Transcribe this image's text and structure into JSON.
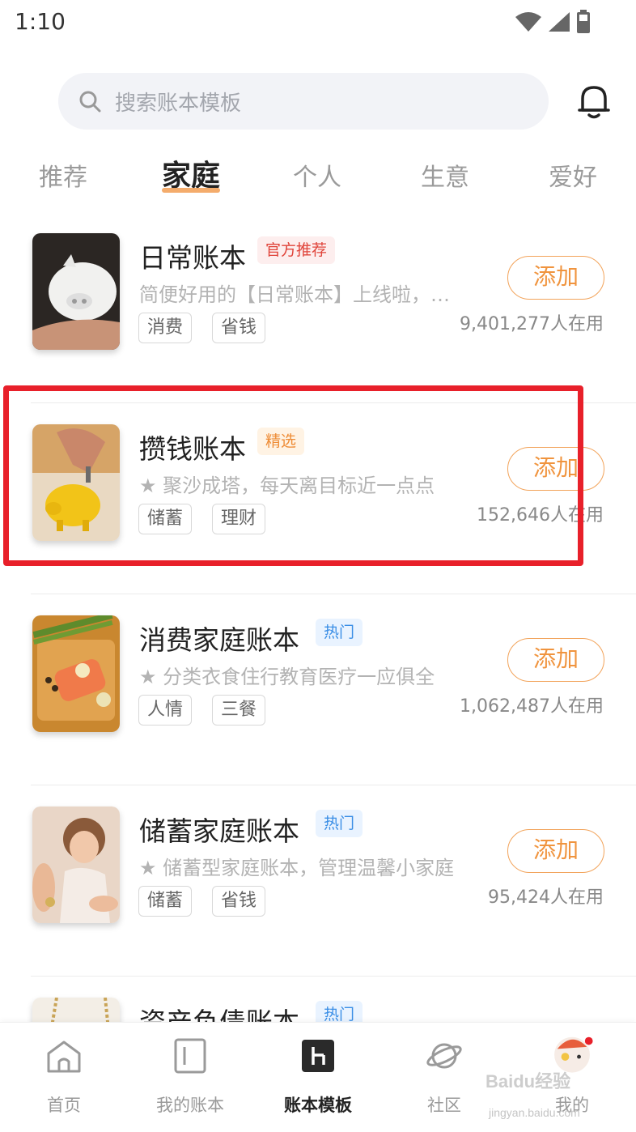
{
  "status_bar": {
    "time": "1:10"
  },
  "search": {
    "placeholder": "搜索账本模板"
  },
  "tabs": [
    {
      "label": "推荐",
      "active": false
    },
    {
      "label": "家庭",
      "active": true
    },
    {
      "label": "个人",
      "active": false
    },
    {
      "label": "生意",
      "active": false
    },
    {
      "label": "爱好",
      "active": false
    }
  ],
  "items": [
    {
      "title": "日常账本",
      "badge": "官方推荐",
      "badge_color": "#e0443a",
      "desc": "简便好用的【日常账本】上线啦，快来添加体验吧",
      "tags": [
        "消费",
        "省钱"
      ],
      "button": "添加",
      "users": "9,401,277人在用"
    },
    {
      "title": "攒钱账本",
      "badge": "精选",
      "badge_color": "#ee8c36",
      "desc": "★ 聚沙成塔，每天离目标近一点点",
      "tags": [
        "储蓄",
        "理财"
      ],
      "button": "添加",
      "users": "152,646人在用"
    },
    {
      "title": "消费家庭账本",
      "badge": "热门",
      "badge_color": "#3a8ee6",
      "desc": "★ 分类衣食住行教育医疗一应俱全",
      "tags": [
        "人情",
        "三餐"
      ],
      "button": "添加",
      "users": "1,062,487人在用"
    },
    {
      "title": "储蓄家庭账本",
      "badge": "热门",
      "badge_color": "#3a8ee6",
      "desc": "★ 储蓄型家庭账本，管理温馨小家庭",
      "tags": [
        "储蓄",
        "省钱"
      ],
      "button": "添加",
      "users": "95,424人在用"
    },
    {
      "title": "资产负债账本",
      "badge": "热门",
      "badge_color": "#3a8ee6"
    }
  ],
  "bottom_nav": [
    {
      "label": "首页",
      "icon": "home-icon"
    },
    {
      "label": "我的账本",
      "icon": "book-icon"
    },
    {
      "label": "账本模板",
      "icon": "template-icon",
      "active": true
    },
    {
      "label": "社区",
      "icon": "planet-icon"
    },
    {
      "label": "我的",
      "icon": "avatar-icon"
    }
  ],
  "watermark": {
    "text": "Baidu经验",
    "sub": "jingyan.baidu.com"
  },
  "colors": {
    "accent": "#f0943e",
    "highlight": "#e8202a"
  }
}
